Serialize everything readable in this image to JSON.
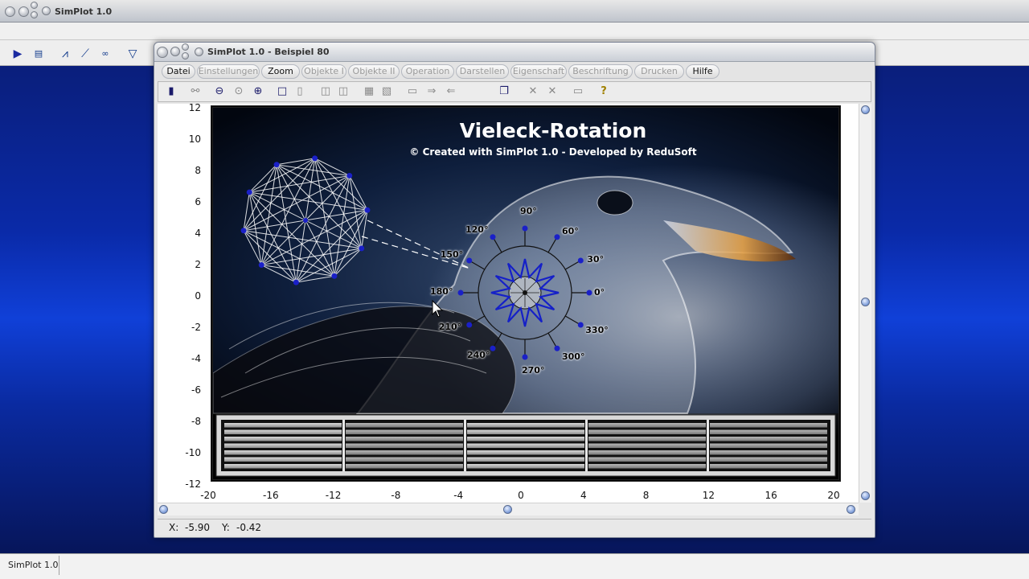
{
  "app": {
    "title": "SimPlot 1.0",
    "status": "SimPlot 1.0"
  },
  "child_window": {
    "title": "SimPlot 1.0 - Beispiel 80"
  },
  "menu": [
    {
      "label": "Datei",
      "enabled": true
    },
    {
      "label": "Einstellungen",
      "enabled": false
    },
    {
      "label": "Zoom",
      "enabled": true
    },
    {
      "label": "Objekte I",
      "enabled": false
    },
    {
      "label": "Objekte II",
      "enabled": false
    },
    {
      "label": "Operation",
      "enabled": false
    },
    {
      "label": "Darstellen",
      "enabled": false
    },
    {
      "label": "Eigenschaft",
      "enabled": false
    },
    {
      "label": "Beschriftung",
      "enabled": false
    },
    {
      "label": "Drucken",
      "enabled": false
    },
    {
      "label": "Hilfe",
      "enabled": true
    }
  ],
  "plot": {
    "title": "Vieleck-Rotation",
    "subtitle": "© Created with SimPlot 1.0 - Developed by ReduSoft",
    "y_ticks": [
      "12",
      "10",
      "8",
      "6",
      "4",
      "2",
      "0",
      "-2",
      "-4",
      "-6",
      "-8",
      "-10",
      "-12"
    ],
    "x_ticks": [
      "-20",
      "-16",
      "-12",
      "-8",
      "-4",
      "0",
      "4",
      "8",
      "12",
      "16",
      "20"
    ],
    "angles": [
      "90°",
      "60°",
      "30°",
      "0°",
      "330°",
      "300°",
      "270°",
      "240°",
      "210°",
      "180°",
      "150°",
      "120°"
    ]
  },
  "coords": {
    "x_label": "X:",
    "x_value": "-5.90",
    "y_label": "Y:",
    "y_value": "-0.42"
  }
}
